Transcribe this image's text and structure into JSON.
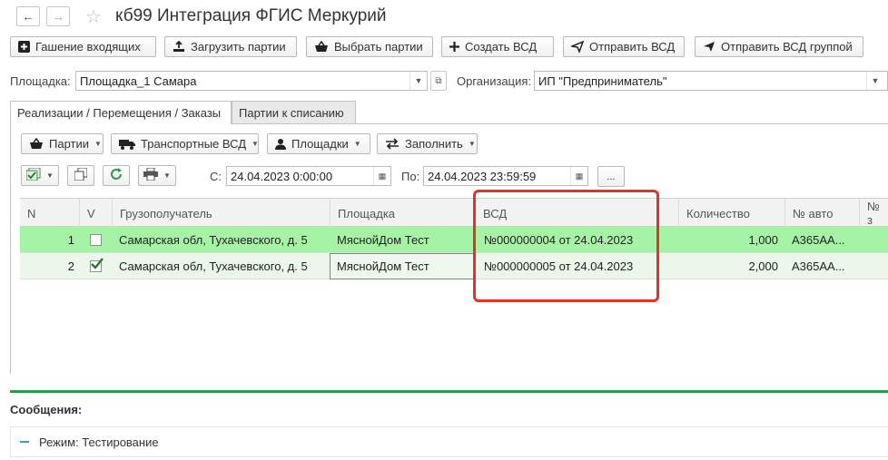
{
  "window": {
    "title": "кб99 Интеграция ФГИС Меркурий"
  },
  "toolbar": {
    "buttons": [
      "Гашение входящих",
      "Загрузить партии",
      "Выбрать партии",
      "Создать ВСД",
      "Отправить ВСД",
      "Отправить ВСД группой"
    ]
  },
  "filters": {
    "site_label": "Площадка:",
    "site_value": "Площадка_1 Самара",
    "org_label": "Организация:",
    "org_value": "ИП \"Предприниматель\""
  },
  "tabs": [
    "Реализации / Перемещения / Заказы",
    "Партии к списанию"
  ],
  "subtoolbar": {
    "buttons": [
      "Партии",
      "Транспортные ВСД",
      "Площадки",
      "Заполнить"
    ]
  },
  "period": {
    "from_label": "С:",
    "from_value": "24.04.2023  0:00:00",
    "to_label": "По:",
    "to_value": "24.04.2023 23:59:59",
    "more": "..."
  },
  "table": {
    "columns": [
      "N",
      "V",
      "Грузополучатель",
      "Площадка",
      "ВСД",
      "Количество",
      "№ авто",
      "№ з"
    ],
    "rows": [
      {
        "n": "1",
        "checked": false,
        "recipient": "Самарская обл, Тухачевского, д. 5",
        "site": "МяснойДом Тест",
        "vsd": "№000000004 от 24.04.2023",
        "qty": "1,000",
        "auto": "А365АА..."
      },
      {
        "n": "2",
        "checked": true,
        "recipient": "Самарская обл, Тухачевского, д. 5",
        "site": "МяснойДом Тест",
        "vsd": "№000000005 от 24.04.2023",
        "qty": "2,000",
        "auto": "А365АА..."
      }
    ]
  },
  "messages": {
    "title": "Сообщения:",
    "items": [
      "Режим: Тестирование"
    ]
  },
  "colors": {
    "row_highlight": "#a5f3a5",
    "row_selected": "#eaf7ea",
    "highlight_box": "#e0332a",
    "splitter": "#2a9b4a"
  }
}
